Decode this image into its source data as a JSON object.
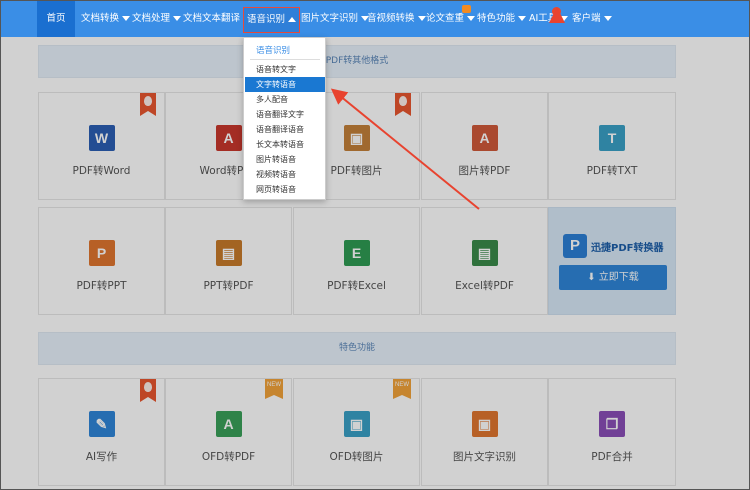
{
  "nav": {
    "items": [
      {
        "label": "首页"
      },
      {
        "label": "文档转换"
      },
      {
        "label": "文档处理"
      },
      {
        "label": "文档文本翻译"
      },
      {
        "label": "语音识别"
      },
      {
        "label": "图片文字识别"
      },
      {
        "label": "音视频转换"
      },
      {
        "label": "论文查重"
      },
      {
        "label": "特色功能"
      },
      {
        "label": "AI工具"
      },
      {
        "label": "客户端"
      }
    ]
  },
  "dropdown": {
    "title": "语音识别",
    "items": [
      "语音转文字",
      "文字转语音",
      "多人配音",
      "语音翻译文字",
      "语音翻译语音",
      "长文本转语音",
      "图片转语音",
      "视频转语音",
      "网页转语音"
    ],
    "selected_index": 1
  },
  "sections": {
    "other_formats": "PDF转其他格式",
    "features": "特色功能"
  },
  "row1": [
    {
      "label": "PDF转Word",
      "icon": "W",
      "color": "#2b5fb4",
      "tag": "hot"
    },
    {
      "label": "Word转PDF",
      "icon": "A",
      "color": "#c8382c",
      "tag": ""
    },
    {
      "label": "PDF转图片",
      "icon": "▣",
      "color": "#c4803a",
      "tag": "hot"
    },
    {
      "label": "图片转PDF",
      "icon": "A",
      "color": "#d05a3a",
      "tag": ""
    },
    {
      "label": "PDF转TXT",
      "icon": "T",
      "color": "#3aa0c6",
      "tag": ""
    }
  ],
  "row2": [
    {
      "label": "PDF转PPT",
      "icon": "P",
      "color": "#e0762f",
      "tag": ""
    },
    {
      "label": "PPT转PDF",
      "icon": "▤",
      "color": "#c77a2a",
      "tag": ""
    },
    {
      "label": "PDF转Excel",
      "icon": "E",
      "color": "#2f9b53",
      "tag": ""
    },
    {
      "label": "Excel转PDF",
      "icon": "▤",
      "color": "#3a8a4a",
      "tag": ""
    }
  ],
  "promo": {
    "name": "迅捷PDF转换器",
    "download": "立即下载"
  },
  "row3": [
    {
      "label": "AI写作",
      "icon": "✎",
      "color": "#2f86d8",
      "tag": "hot"
    },
    {
      "label": "OFD转PDF",
      "icon": "A",
      "color": "#3aa05a",
      "tag": "new"
    },
    {
      "label": "OFD转图片",
      "icon": "▣",
      "color": "#3aa0c6",
      "tag": "new"
    },
    {
      "label": "图片文字识别",
      "icon": "▣",
      "color": "#e0762f",
      "tag": ""
    },
    {
      "label": "PDF合并",
      "icon": "❐",
      "color": "#8a4fb8",
      "tag": ""
    }
  ],
  "tags": {
    "new_text": "NEW"
  }
}
